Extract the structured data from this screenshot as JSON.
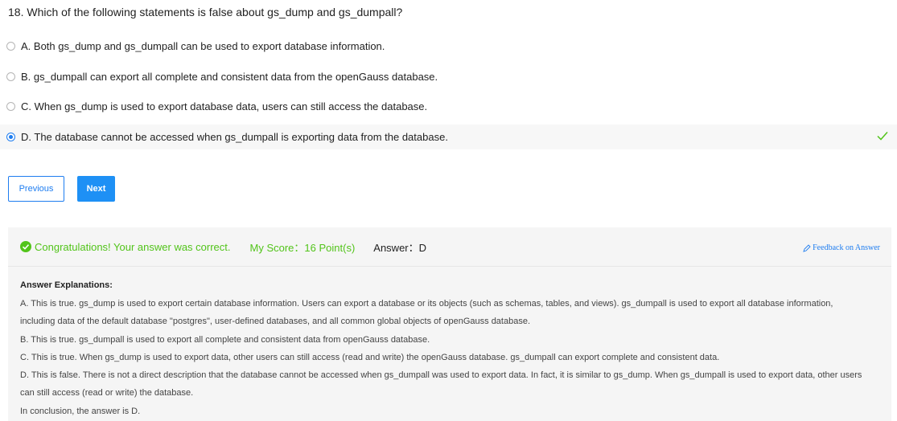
{
  "question": {
    "text": "18. Which of the following statements is false about gs_dump and gs_dumpall?"
  },
  "options": [
    {
      "label": "A. Both gs_dump and gs_dumpall can be used to export database information."
    },
    {
      "label": "B. gs_dumpall can export all complete and consistent data from the openGauss database."
    },
    {
      "label": "C. When gs_dump is used to export database data, users can still access the database."
    },
    {
      "label": "D. The database cannot be accessed when gs_dumpall is exporting data from the database."
    }
  ],
  "selected_option": "D",
  "buttons": {
    "previous": "Previous",
    "next": "Next"
  },
  "result": {
    "congrats": "Congratulations! Your answer was correct.",
    "score": "My Score：16 Point(s)",
    "answer": "Answer：D",
    "feedback": "Feedback on Answer"
  },
  "explanation": {
    "title": "Answer Explanations:",
    "lines": [
      "A. This is true. gs_dump is used to export certain database information. Users can export a database or its objects (such as schemas, tables, and views). gs_dumpall is used to export all database information,",
      "including data of the default database \"postgres\", user-defined databases, and all common global objects of openGauss database.",
      "B. This is true. gs_dumpall is used to export all complete and consistent data from openGauss database.",
      "C. This is true. When gs_dump is used to export data, other users can still access (read and write) the openGauss database. gs_dumpall can export complete and consistent data.",
      "D. This is false. There is not a direct description that the database cannot be accessed when gs_dumpall was used to export data. In fact, it is similar to gs_dump. When gs_dumpall is used to export data, other users",
      "can still access (read or write) the database.",
      "In conclusion, the answer is D."
    ]
  },
  "colors": {
    "accent": "#1e7df0",
    "success": "#52c41a"
  },
  "icons": {
    "correct": "checkmark-icon",
    "ok": "check-circle-icon",
    "feedback": "edit-icon"
  }
}
